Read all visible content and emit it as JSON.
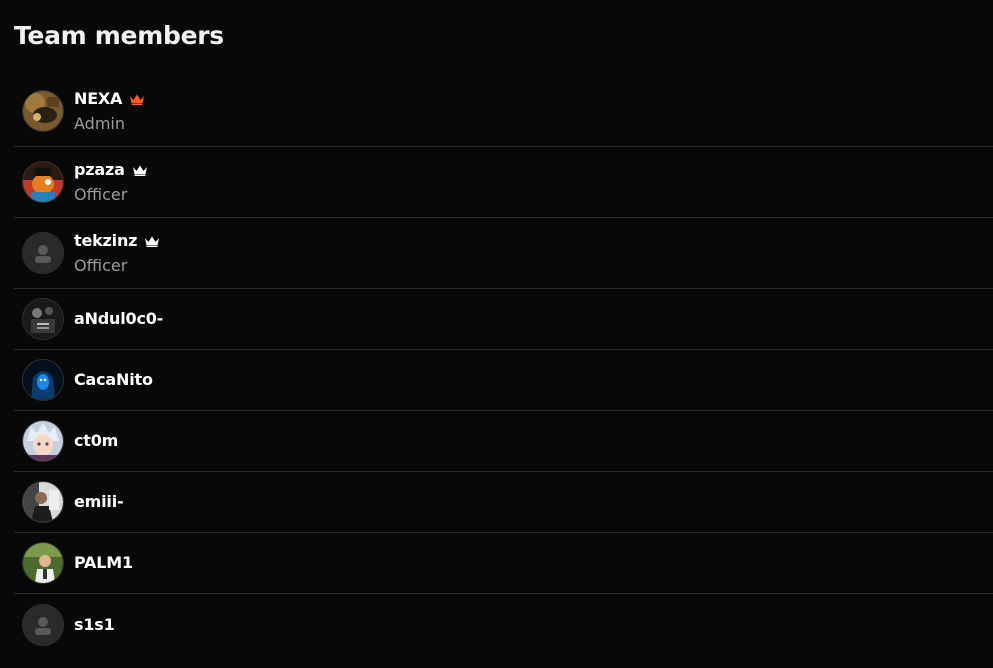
{
  "header": {
    "title": "Team members"
  },
  "colors": {
    "background": "#080808",
    "divider": "#2b2b2b",
    "admin_crown": "#ff5a1f",
    "officer_crown": "#ffffff",
    "role_text": "#9c9c9c"
  },
  "members": [
    {
      "name": "NEXA",
      "role": "Admin",
      "crown": "orange",
      "avatar": "photo-brown"
    },
    {
      "name": "pzaza",
      "role": "Officer",
      "crown": "white",
      "avatar": "cartoon-orange"
    },
    {
      "name": "tekzinz",
      "role": "Officer",
      "crown": "white",
      "avatar": "default-placeholder"
    },
    {
      "name": "aNdul0c0-",
      "role": "",
      "crown": "",
      "avatar": "photo-bw"
    },
    {
      "name": "CacaNito",
      "role": "",
      "crown": "",
      "avatar": "hooded-blue"
    },
    {
      "name": "ct0m",
      "role": "",
      "crown": "",
      "avatar": "anime-silver"
    },
    {
      "name": "emiii-",
      "role": "",
      "crown": "",
      "avatar": "photo-person"
    },
    {
      "name": "PALM1",
      "role": "",
      "crown": "",
      "avatar": "photo-person-green"
    },
    {
      "name": "s1s1",
      "role": "",
      "crown": "",
      "avatar": "default-placeholder"
    }
  ]
}
